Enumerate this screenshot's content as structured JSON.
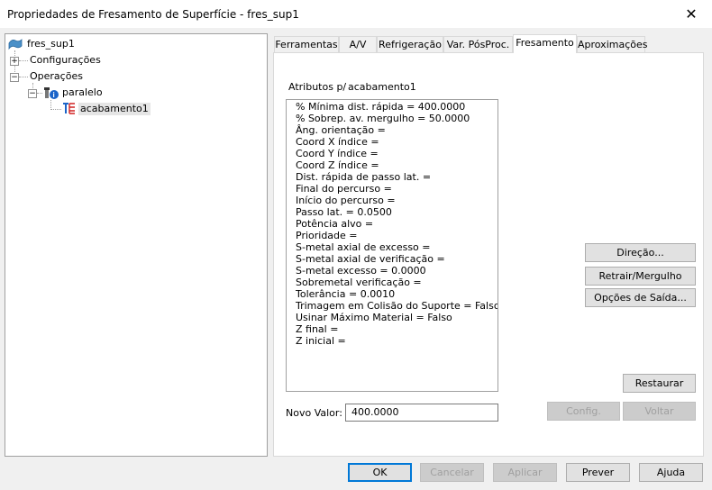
{
  "window": {
    "title": "Propriedades de Fresamento de Superfície - fres_sup1",
    "close_glyph": "✕"
  },
  "tree": {
    "root": {
      "label": "fres_sup1",
      "icon": "surface-icon"
    },
    "configuracoes": {
      "label": "Configurações",
      "expander": "+"
    },
    "operacoes": {
      "label": "Operações",
      "expander": "−"
    },
    "paralelo": {
      "label": "paralelo",
      "expander": "−",
      "icon": "operation-info-icon"
    },
    "acabamento": {
      "label": "acabamento1",
      "icon": "toolpath-icon"
    }
  },
  "tabs": [
    {
      "label": "Ferramentas"
    },
    {
      "label": "A/V"
    },
    {
      "label": "Refrigeração"
    },
    {
      "label": "Var. PósProc."
    },
    {
      "label": "Fresamento",
      "active": true
    },
    {
      "label": "Aproximações"
    }
  ],
  "panel": {
    "attributes_label": "Atributos p/",
    "attributes_target": "acabamento1",
    "attributes": [
      "% Mínima dist. rápida = 400.0000",
      "% Sobrep. av. mergulho = 50.0000",
      "Âng. orientação =",
      "Coord X índice =",
      "Coord Y índice =",
      "Coord Z índice =",
      "Dist. rápida de passo lat. =",
      "Final do percurso =",
      "Início do percurso =",
      "Passo lat. = 0.0500",
      "Potência alvo =",
      "Prioridade =",
      "S-metal axial de excesso =",
      "S-metal axial de verificação =",
      "S-metal excesso = 0.0000",
      "Sobremetal verificação =",
      "Tolerância = 0.0010",
      "Trimagem em Colisão do Suporte = Falso",
      "Usinar Máximo Material = Falso",
      "Z final =",
      "Z inicial ="
    ],
    "novo_valor_label": "Novo Valor:",
    "novo_valor": "400.0000",
    "buttons": {
      "direcao": "Direção...",
      "retrair": "Retrair/Mergulho",
      "opcoes_saida": "Opções de Saída...",
      "restaurar": "Restaurar",
      "config": "Config.",
      "voltar": "Voltar"
    }
  },
  "footer": {
    "ok": "OK",
    "cancelar": "Cancelar",
    "aplicar": "Aplicar",
    "prever": "Prever",
    "ajuda": "Ajuda"
  }
}
